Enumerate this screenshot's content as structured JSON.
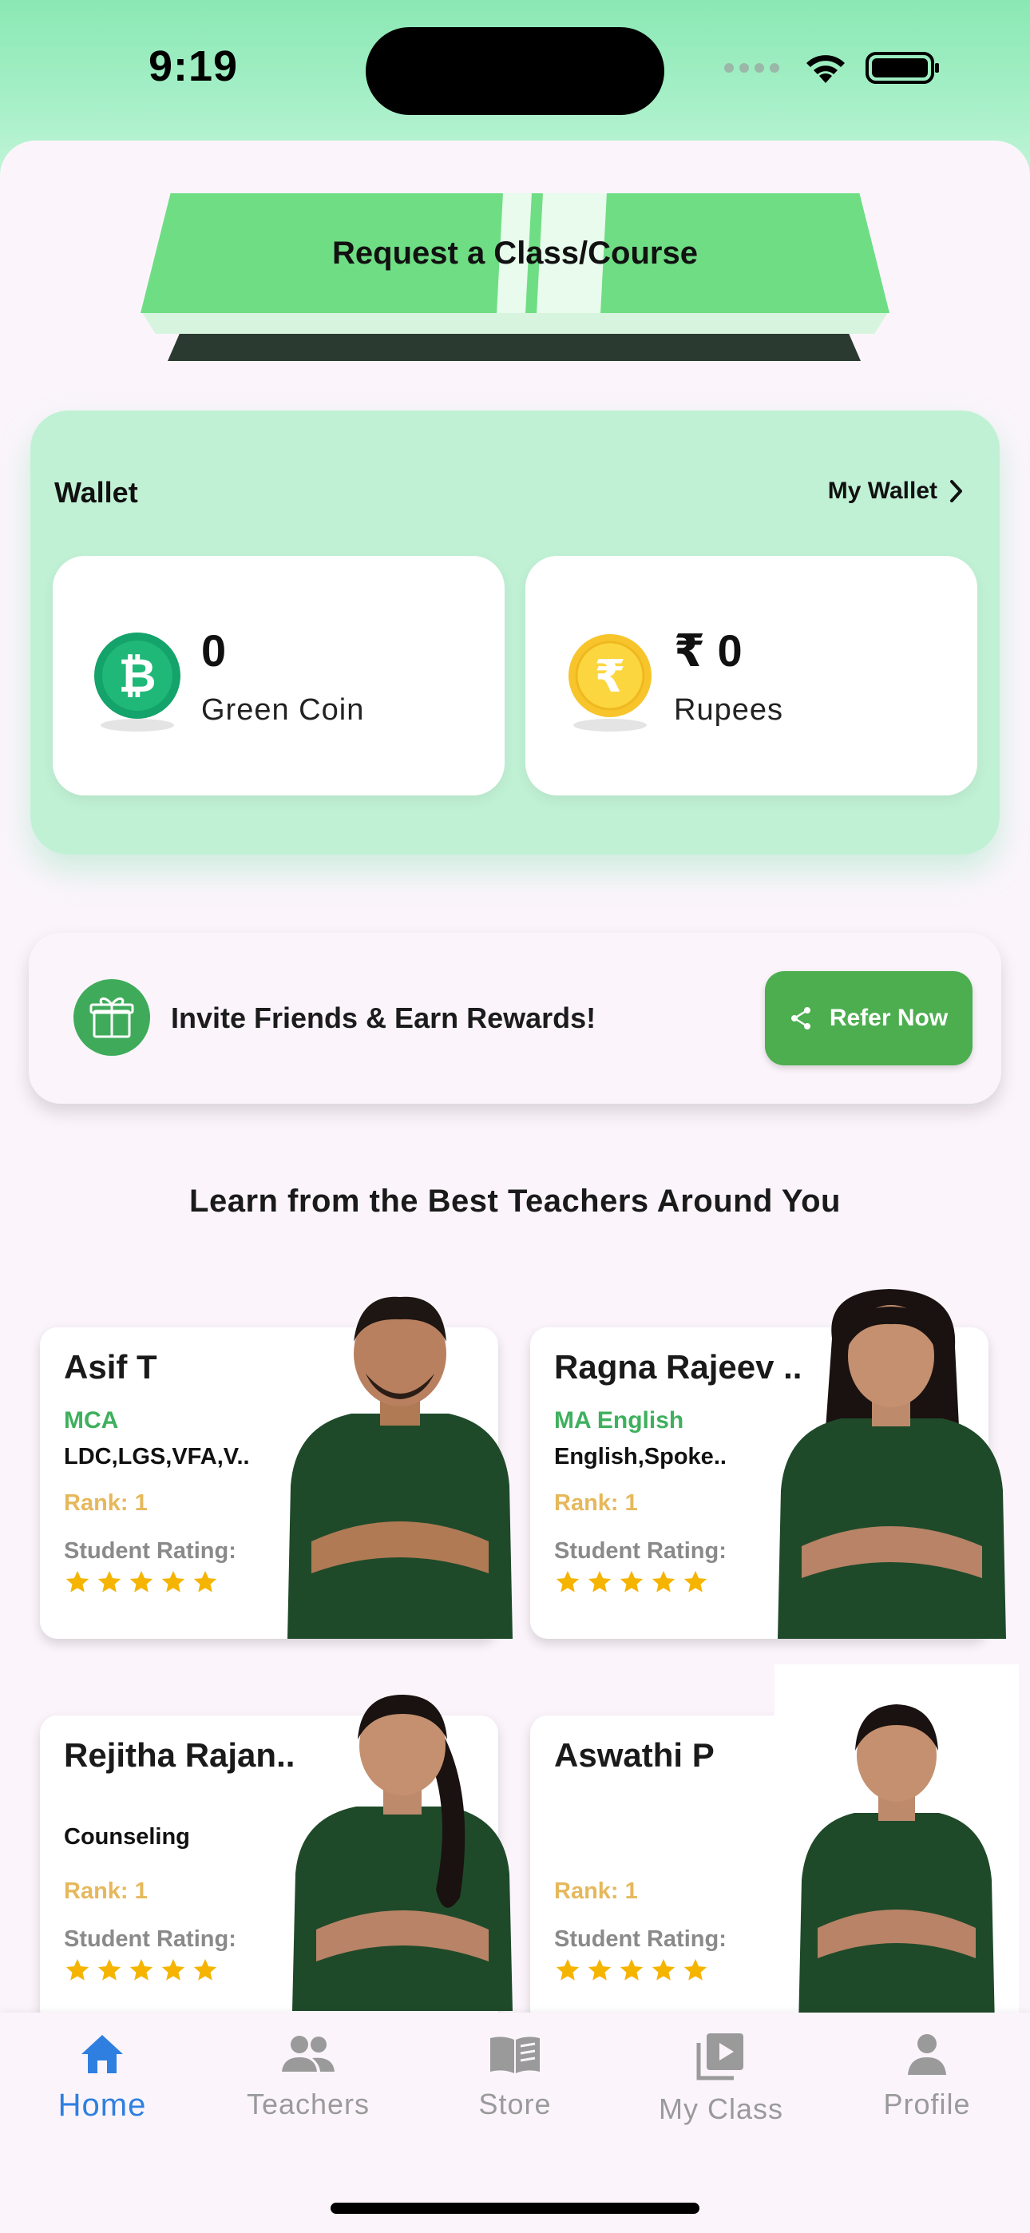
{
  "status": {
    "time": "9:19"
  },
  "request": {
    "label": "Request a Class/Course"
  },
  "wallet": {
    "title": "Wallet",
    "link_label": "My Wallet",
    "cards": [
      {
        "value": "0",
        "label": "Green Coin",
        "icon": "bitcoin-coin-icon"
      },
      {
        "value": "₹ 0",
        "label": "Rupees",
        "icon": "rupee-coin-icon"
      }
    ]
  },
  "refer": {
    "text": "Invite Friends & Earn Rewards!",
    "button": "Refer Now",
    "icon": "gift-icon"
  },
  "teachers_section": {
    "title": "Learn from the Best Teachers Around You"
  },
  "teachers": [
    {
      "name": "Asif T",
      "qualification": "MCA",
      "subjects": "LDC,LGS,VFA,V..",
      "rank": "Rank: 1",
      "rating_label": "Student Rating:",
      "stars": 5
    },
    {
      "name": "Ragna Rajeev ..",
      "qualification": "MA English",
      "subjects": "English,Spoke..",
      "rank": "Rank: 1",
      "rating_label": "Student Rating:",
      "stars": 5
    },
    {
      "name": "Rejitha Rajan..",
      "qualification": "",
      "subjects": "Counseling",
      "rank": "Rank: 1",
      "rating_label": "Student Rating:",
      "stars": 5
    },
    {
      "name": "Aswathi P",
      "qualification": "",
      "subjects": "",
      "rank": "Rank: 1",
      "rating_label": "Student Rating:",
      "stars": 5
    }
  ],
  "nav": [
    {
      "label": "Home",
      "icon": "home-icon",
      "active": true
    },
    {
      "label": "Teachers",
      "icon": "people-icon"
    },
    {
      "label": "Store",
      "icon": "book-icon"
    },
    {
      "label": "My Class",
      "icon": "video-library-icon"
    },
    {
      "label": "Profile",
      "icon": "person-icon"
    }
  ],
  "colors": {
    "accent_green": "#4cae4f",
    "nav_active": "#2f7fe0",
    "wallet_bg": "#c1f1d5",
    "rank": "#e6b85c",
    "star": "#f5b400"
  }
}
